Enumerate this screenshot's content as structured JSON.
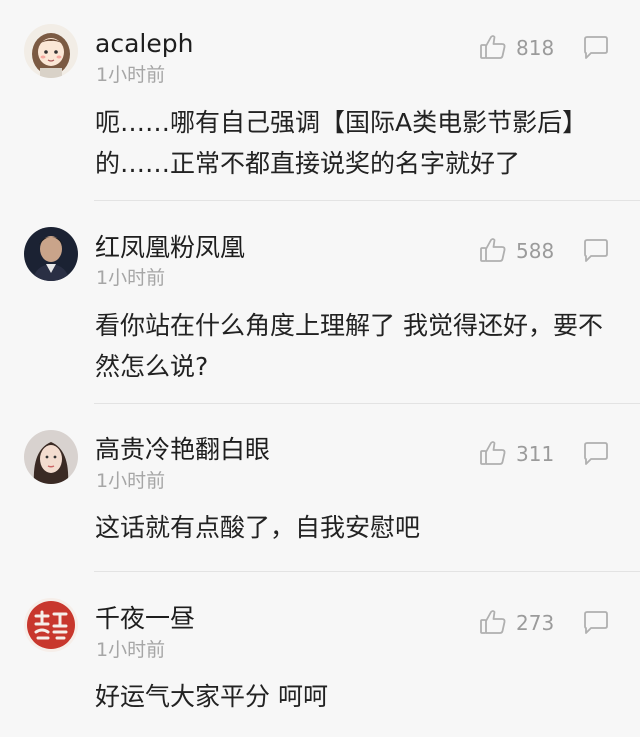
{
  "comments": [
    {
      "username": "acaleph",
      "time": "1小时前",
      "likes": "818",
      "text": "呃……哪有自己强调【国际A类电影节影后】的……正常不都直接说奖的名字就好了",
      "avatar_icon": "cartoon-girl-avatar"
    },
    {
      "username": "红凤凰粉凤凰",
      "time": "1小时前",
      "likes": "588",
      "text": "看你站在什么角度上理解了 我觉得还好，要不然怎么说?",
      "avatar_icon": "young-man-photo-avatar"
    },
    {
      "username": "高贵冷艳翻白眼",
      "time": "1小时前",
      "likes": "311",
      "text": "这话就有点酸了，自我安慰吧",
      "avatar_icon": "woman-photo-avatar"
    },
    {
      "username": "千夜一昼",
      "time": "1小时前",
      "likes": "273",
      "text": "好运气大家平分 呵呵",
      "avatar_icon": "red-seal-avatar"
    }
  ],
  "colors": {
    "background": "#f7f7f7",
    "username": "#1e1e1e",
    "meta": "#a6a6a6",
    "icon": "#b0b0b0"
  }
}
